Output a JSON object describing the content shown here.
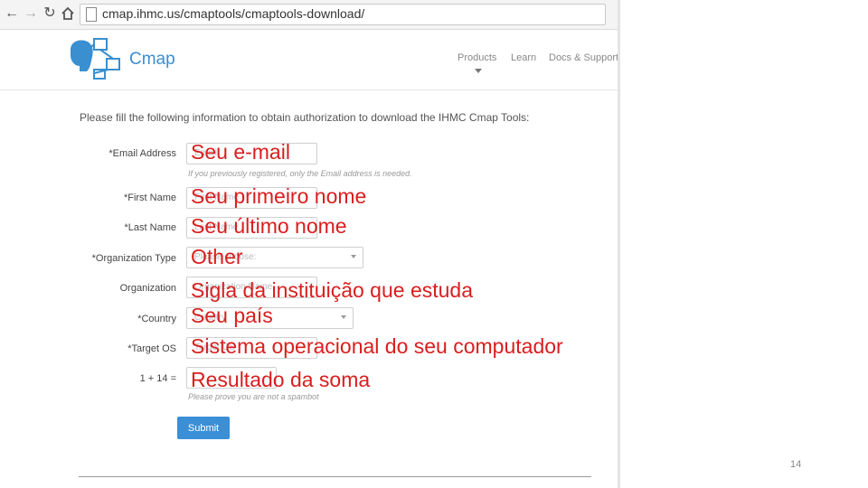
{
  "browser": {
    "back_icon": "arrow-left-icon",
    "forward_icon": "arrow-right-icon",
    "reload_icon": "reload-icon",
    "home_icon": "home-icon",
    "url": "cmap.ihmc.us/cmaptools/cmaptools-download/"
  },
  "site": {
    "logo_text": "Cmap",
    "brand_color": "#3a8fd0",
    "nav": [
      "Products",
      "Learn",
      "Docs & Support"
    ]
  },
  "form": {
    "intro": "Please fill the following information to obtain authorization to download the IHMC Cmap Tools:",
    "email_help": "If you previously registered, only the Email address is needed.",
    "captcha_help": "Please prove you are not a spambot",
    "fields": [
      {
        "label": "*Email Address",
        "placeholder": "Email"
      },
      {
        "label": "*First Name",
        "placeholder": "First Name"
      },
      {
        "label": "*Last Name",
        "placeholder": "Last Name"
      },
      {
        "label": "*Organization Type",
        "placeholder": "Please choose:"
      },
      {
        "label": "Organization",
        "placeholder": "Organization Name"
      },
      {
        "label": "*Country",
        "placeholder": "Country"
      },
      {
        "label": "*Target OS",
        "placeholder": "Target OS"
      },
      {
        "label": "1 + 14 =",
        "placeholder": ""
      }
    ],
    "submit_label": "Submit",
    "submit_color": "#3a8fd6"
  },
  "annotations": [
    "Seu e-mail",
    "Seu primeiro nome",
    "Seu último nome",
    "Other",
    "Sigla da instituição que estuda",
    "Seu país",
    "Sistema operacional do seu computador",
    "Resultado da soma"
  ],
  "annotation_color": "#d91e1e",
  "slide_number": "14"
}
